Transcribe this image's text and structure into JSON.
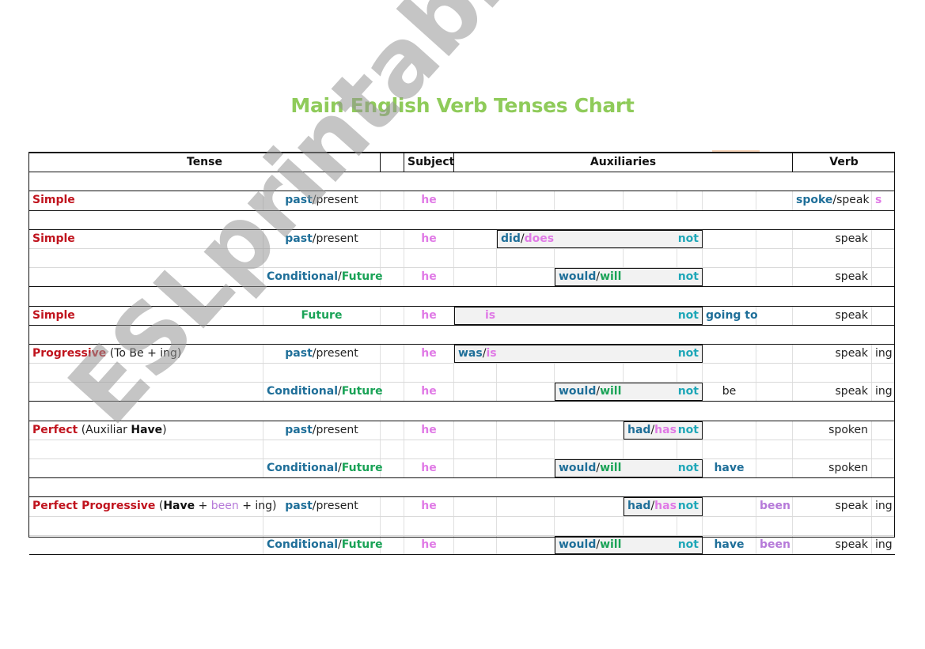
{
  "title": "Main English Verb Tenses Chart",
  "watermark": "ESLprintables.com",
  "header": {
    "tense": "Tense",
    "subject": "Subject",
    "auxiliaries": "Auxiliaries",
    "verb": "Verb"
  },
  "colors": {
    "title": "#8fcb5a",
    "tense_name": "#c0141e",
    "past_conditional": "#1f6f99",
    "future": "#1aa357",
    "present_pink": "#e07ae6",
    "negation": "#1fa7b8",
    "been": "#b67ad9"
  },
  "common": {
    "slash": "/",
    "past": "past",
    "present": "present",
    "conditional": "Conditional",
    "future": "Future",
    "subject": "he",
    "not": "not"
  },
  "rows": {
    "simple1": {
      "tense": "Simple",
      "verb_past": "spoke",
      "verb_present": "speak",
      "ending": "s"
    },
    "simple2": {
      "tense": "Simple",
      "aux_past": "did",
      "aux_present": "does",
      "verb": "speak"
    },
    "simple2_cond": {
      "aux_cond": "would",
      "aux_future": "will",
      "verb": "speak"
    },
    "simple_future": {
      "tense": "Simple",
      "type": "Future",
      "aux": "is",
      "extra": "going to",
      "verb": "speak"
    },
    "progressive": {
      "tense": "Progressive",
      "note": "(To Be + ing)",
      "aux_past": "was",
      "aux_present": "is",
      "verb": "speak",
      "ending": "ing"
    },
    "progressive_cond": {
      "aux_cond": "would",
      "aux_future": "will",
      "extra": "be",
      "verb": "speak",
      "ending": "ing"
    },
    "perfect": {
      "tense": "Perfect",
      "note_open": "(Auxiliar ",
      "note_bold": "Have",
      "note_close": ")",
      "aux_past": "had",
      "aux_present": "has",
      "verb": "spoken"
    },
    "perfect_cond": {
      "aux_cond": "would",
      "aux_future": "will",
      "extra": "have",
      "verb": "spoken"
    },
    "perfect_progressive": {
      "tense": "Perfect Progressive",
      "note_open": "(",
      "note_have": "Have",
      "note_plus1": " + ",
      "note_been": "been",
      "note_plus2": " + ing)",
      "aux_past": "had",
      "aux_present": "has",
      "been": "been",
      "verb": "speak",
      "ending": "ing"
    },
    "perfect_progressive_cond": {
      "aux_cond": "would",
      "aux_future": "will",
      "extra": "have",
      "been": "been",
      "verb": "speak",
      "ending": "ing"
    }
  }
}
